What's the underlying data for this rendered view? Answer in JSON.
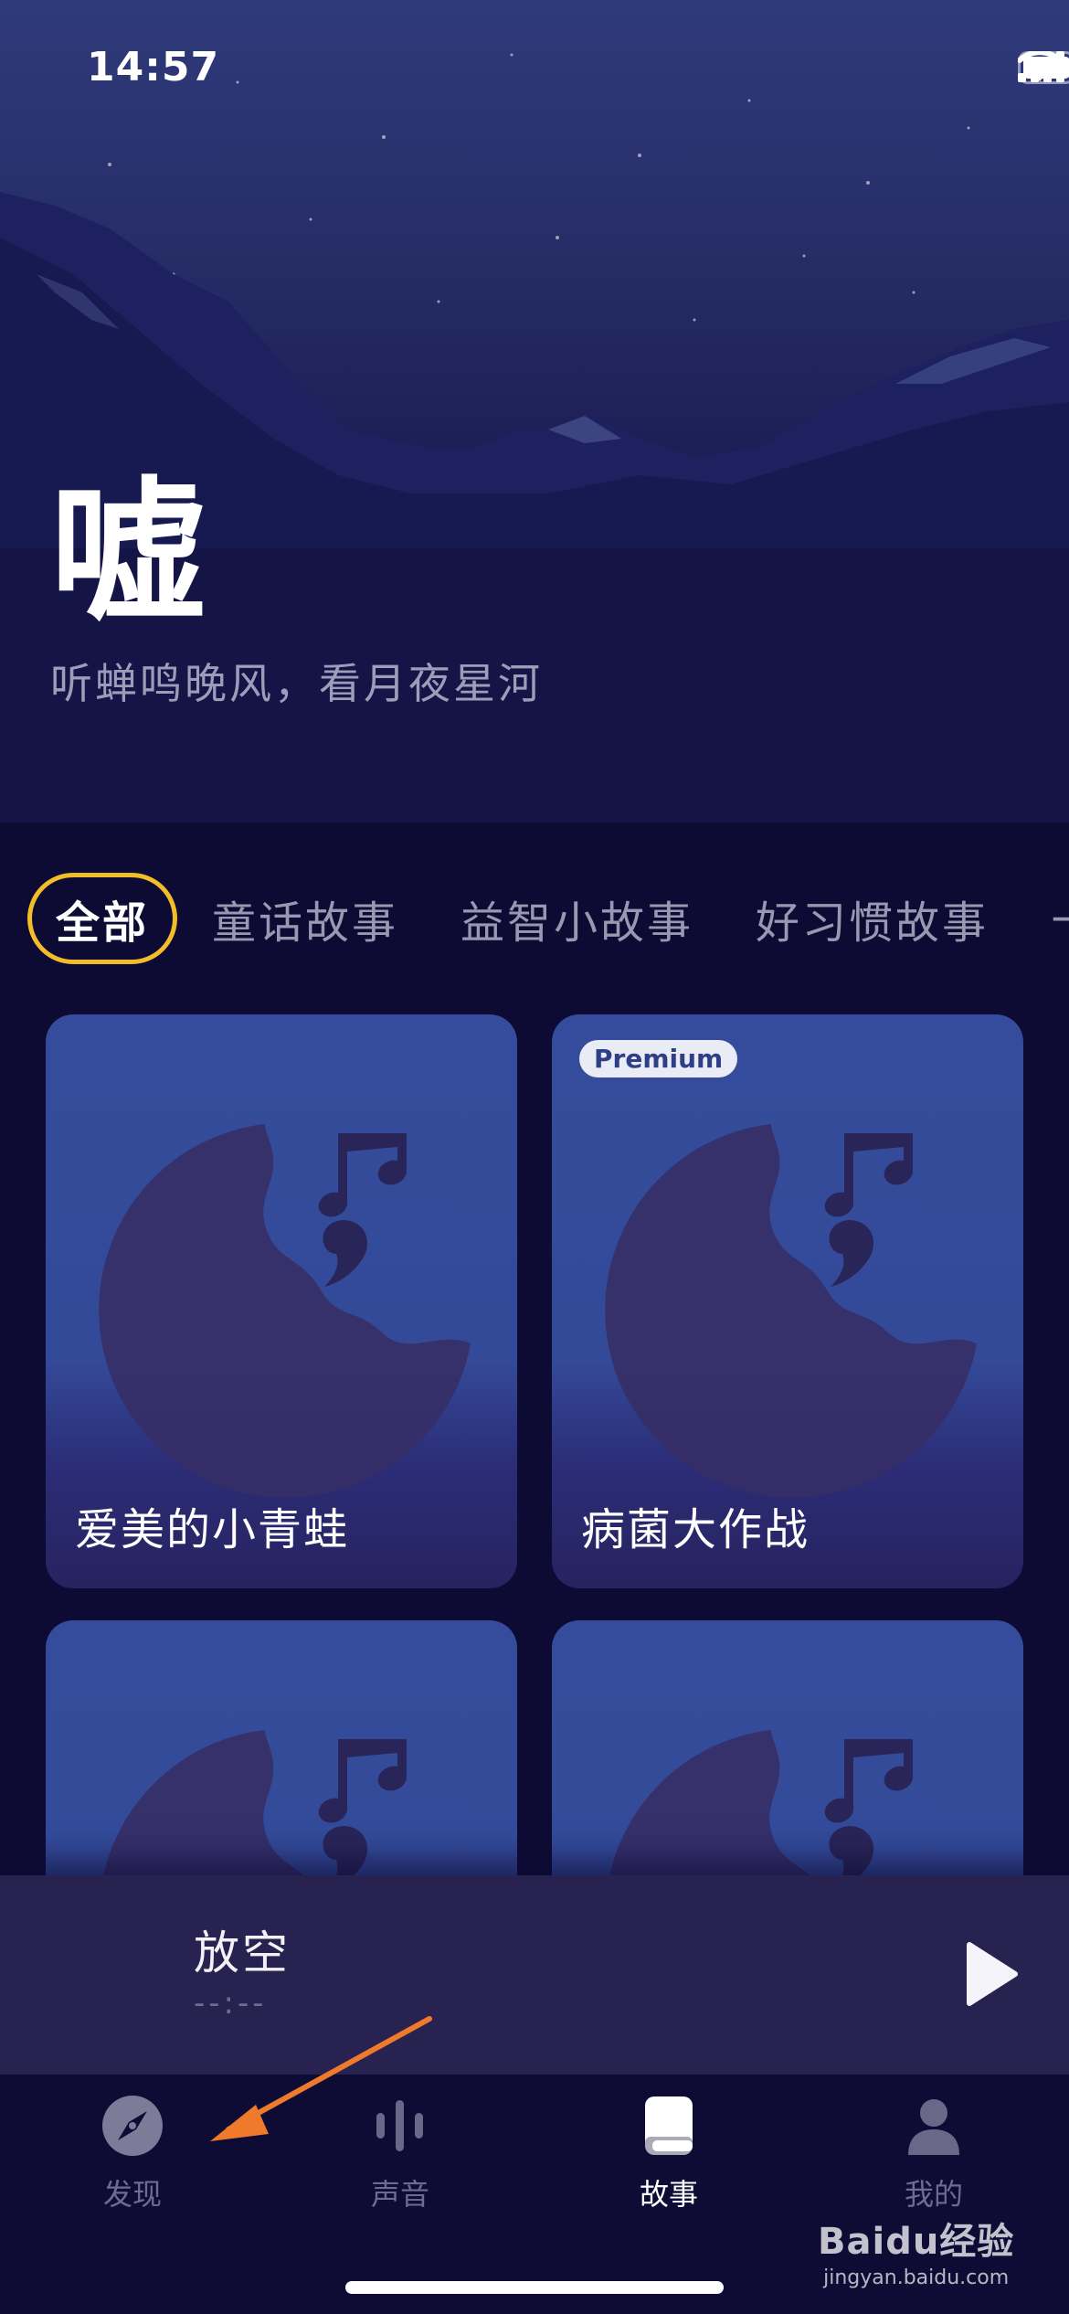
{
  "status": {
    "time": "14:57",
    "icons": [
      "signal-icon",
      "wifi-icon",
      "battery-icon"
    ]
  },
  "hero": {
    "title": "嘘",
    "subtitle": "听蝉鸣晚风，看月夜星河"
  },
  "category_tabs": [
    {
      "label": "全部",
      "active": true
    },
    {
      "label": "童话故事",
      "active": false
    },
    {
      "label": "益智小故事",
      "active": false
    },
    {
      "label": "好习惯故事",
      "active": false
    },
    {
      "label": "十",
      "active": false
    }
  ],
  "stories": [
    {
      "title": "爱美的小青蛙",
      "badge": ""
    },
    {
      "title": "病菌大作战",
      "badge": "Premium"
    },
    {
      "title": "",
      "badge": ""
    },
    {
      "title": "",
      "badge": ""
    }
  ],
  "player": {
    "title": "放空",
    "time": "--:--",
    "icon": "play-icon"
  },
  "bottom_nav": [
    {
      "label": "发现",
      "icon": "compass-icon",
      "active": false
    },
    {
      "label": "声音",
      "icon": "sound-bars-icon",
      "active": false
    },
    {
      "label": "故事",
      "icon": "book-icon",
      "active": true
    },
    {
      "label": "我的",
      "icon": "profile-icon",
      "active": false
    }
  ],
  "watermark": {
    "brand": "Baidu经验",
    "url": "jingyan.baidu.com"
  },
  "colors": {
    "active_tab_border": "#f2bd2a",
    "background": "#0d0a33",
    "card": "#344c9b",
    "player": "#27224f",
    "annotation_arrow": "#f07a2c"
  }
}
